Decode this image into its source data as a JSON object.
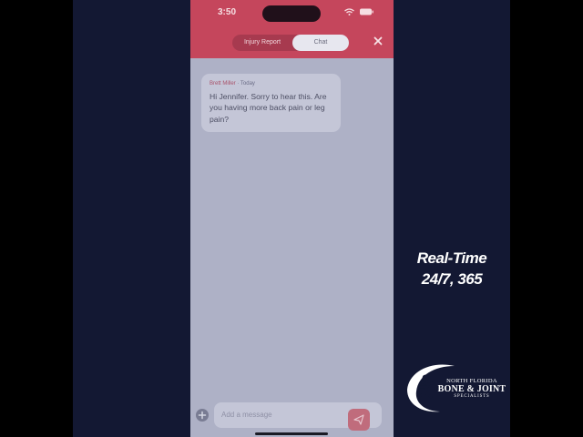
{
  "status_bar": {
    "time": "3:50"
  },
  "header": {
    "tabs": [
      {
        "label": "Injury Report",
        "active": false
      },
      {
        "label": "Chat",
        "active": true
      }
    ]
  },
  "messages": [
    {
      "sender": "Brett Miller",
      "separator": " · ",
      "when": "Today",
      "text": "Hi Jennifer.  Sorry to hear this.  Are you having more back pain or leg pain?"
    }
  ],
  "composer": {
    "placeholder": "Add a message"
  },
  "overlay": {
    "tagline_line1": "Real-Time",
    "tagline_line2": "24/7, 365"
  },
  "logo": {
    "line1": "NORTH FLORIDA",
    "line2": "BONE & JOINT",
    "line3": "SPECIALISTS"
  },
  "colors": {
    "header": "#c5465c",
    "screen_dim": "#aeb1c6",
    "background": "#131833"
  },
  "icons": [
    "wifi-icon",
    "battery-icon",
    "close-icon",
    "plus-icon",
    "send-icon",
    "runner-logo-icon"
  ]
}
